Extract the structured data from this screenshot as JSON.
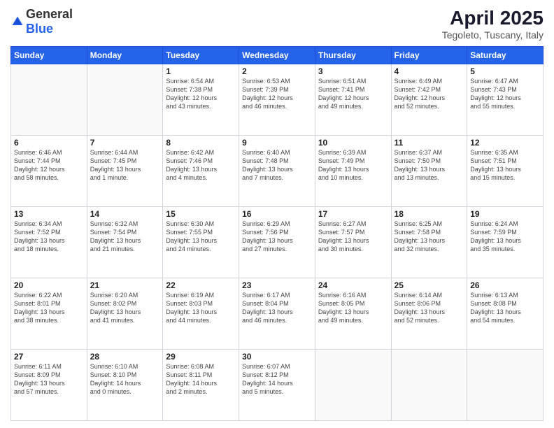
{
  "header": {
    "logo_general": "General",
    "logo_blue": "Blue",
    "month_title": "April 2025",
    "location": "Tegoleto, Tuscany, Italy"
  },
  "weekdays": [
    "Sunday",
    "Monday",
    "Tuesday",
    "Wednesday",
    "Thursday",
    "Friday",
    "Saturday"
  ],
  "weeks": [
    [
      {
        "day": "",
        "info": ""
      },
      {
        "day": "",
        "info": ""
      },
      {
        "day": "1",
        "info": "Sunrise: 6:54 AM\nSunset: 7:38 PM\nDaylight: 12 hours\nand 43 minutes."
      },
      {
        "day": "2",
        "info": "Sunrise: 6:53 AM\nSunset: 7:39 PM\nDaylight: 12 hours\nand 46 minutes."
      },
      {
        "day": "3",
        "info": "Sunrise: 6:51 AM\nSunset: 7:41 PM\nDaylight: 12 hours\nand 49 minutes."
      },
      {
        "day": "4",
        "info": "Sunrise: 6:49 AM\nSunset: 7:42 PM\nDaylight: 12 hours\nand 52 minutes."
      },
      {
        "day": "5",
        "info": "Sunrise: 6:47 AM\nSunset: 7:43 PM\nDaylight: 12 hours\nand 55 minutes."
      }
    ],
    [
      {
        "day": "6",
        "info": "Sunrise: 6:46 AM\nSunset: 7:44 PM\nDaylight: 12 hours\nand 58 minutes."
      },
      {
        "day": "7",
        "info": "Sunrise: 6:44 AM\nSunset: 7:45 PM\nDaylight: 13 hours\nand 1 minute."
      },
      {
        "day": "8",
        "info": "Sunrise: 6:42 AM\nSunset: 7:46 PM\nDaylight: 13 hours\nand 4 minutes."
      },
      {
        "day": "9",
        "info": "Sunrise: 6:40 AM\nSunset: 7:48 PM\nDaylight: 13 hours\nand 7 minutes."
      },
      {
        "day": "10",
        "info": "Sunrise: 6:39 AM\nSunset: 7:49 PM\nDaylight: 13 hours\nand 10 minutes."
      },
      {
        "day": "11",
        "info": "Sunrise: 6:37 AM\nSunset: 7:50 PM\nDaylight: 13 hours\nand 13 minutes."
      },
      {
        "day": "12",
        "info": "Sunrise: 6:35 AM\nSunset: 7:51 PM\nDaylight: 13 hours\nand 15 minutes."
      }
    ],
    [
      {
        "day": "13",
        "info": "Sunrise: 6:34 AM\nSunset: 7:52 PM\nDaylight: 13 hours\nand 18 minutes."
      },
      {
        "day": "14",
        "info": "Sunrise: 6:32 AM\nSunset: 7:54 PM\nDaylight: 13 hours\nand 21 minutes."
      },
      {
        "day": "15",
        "info": "Sunrise: 6:30 AM\nSunset: 7:55 PM\nDaylight: 13 hours\nand 24 minutes."
      },
      {
        "day": "16",
        "info": "Sunrise: 6:29 AM\nSunset: 7:56 PM\nDaylight: 13 hours\nand 27 minutes."
      },
      {
        "day": "17",
        "info": "Sunrise: 6:27 AM\nSunset: 7:57 PM\nDaylight: 13 hours\nand 30 minutes."
      },
      {
        "day": "18",
        "info": "Sunrise: 6:25 AM\nSunset: 7:58 PM\nDaylight: 13 hours\nand 32 minutes."
      },
      {
        "day": "19",
        "info": "Sunrise: 6:24 AM\nSunset: 7:59 PM\nDaylight: 13 hours\nand 35 minutes."
      }
    ],
    [
      {
        "day": "20",
        "info": "Sunrise: 6:22 AM\nSunset: 8:01 PM\nDaylight: 13 hours\nand 38 minutes."
      },
      {
        "day": "21",
        "info": "Sunrise: 6:20 AM\nSunset: 8:02 PM\nDaylight: 13 hours\nand 41 minutes."
      },
      {
        "day": "22",
        "info": "Sunrise: 6:19 AM\nSunset: 8:03 PM\nDaylight: 13 hours\nand 44 minutes."
      },
      {
        "day": "23",
        "info": "Sunrise: 6:17 AM\nSunset: 8:04 PM\nDaylight: 13 hours\nand 46 minutes."
      },
      {
        "day": "24",
        "info": "Sunrise: 6:16 AM\nSunset: 8:05 PM\nDaylight: 13 hours\nand 49 minutes."
      },
      {
        "day": "25",
        "info": "Sunrise: 6:14 AM\nSunset: 8:06 PM\nDaylight: 13 hours\nand 52 minutes."
      },
      {
        "day": "26",
        "info": "Sunrise: 6:13 AM\nSunset: 8:08 PM\nDaylight: 13 hours\nand 54 minutes."
      }
    ],
    [
      {
        "day": "27",
        "info": "Sunrise: 6:11 AM\nSunset: 8:09 PM\nDaylight: 13 hours\nand 57 minutes."
      },
      {
        "day": "28",
        "info": "Sunrise: 6:10 AM\nSunset: 8:10 PM\nDaylight: 14 hours\nand 0 minutes."
      },
      {
        "day": "29",
        "info": "Sunrise: 6:08 AM\nSunset: 8:11 PM\nDaylight: 14 hours\nand 2 minutes."
      },
      {
        "day": "30",
        "info": "Sunrise: 6:07 AM\nSunset: 8:12 PM\nDaylight: 14 hours\nand 5 minutes."
      },
      {
        "day": "",
        "info": ""
      },
      {
        "day": "",
        "info": ""
      },
      {
        "day": "",
        "info": ""
      }
    ]
  ]
}
